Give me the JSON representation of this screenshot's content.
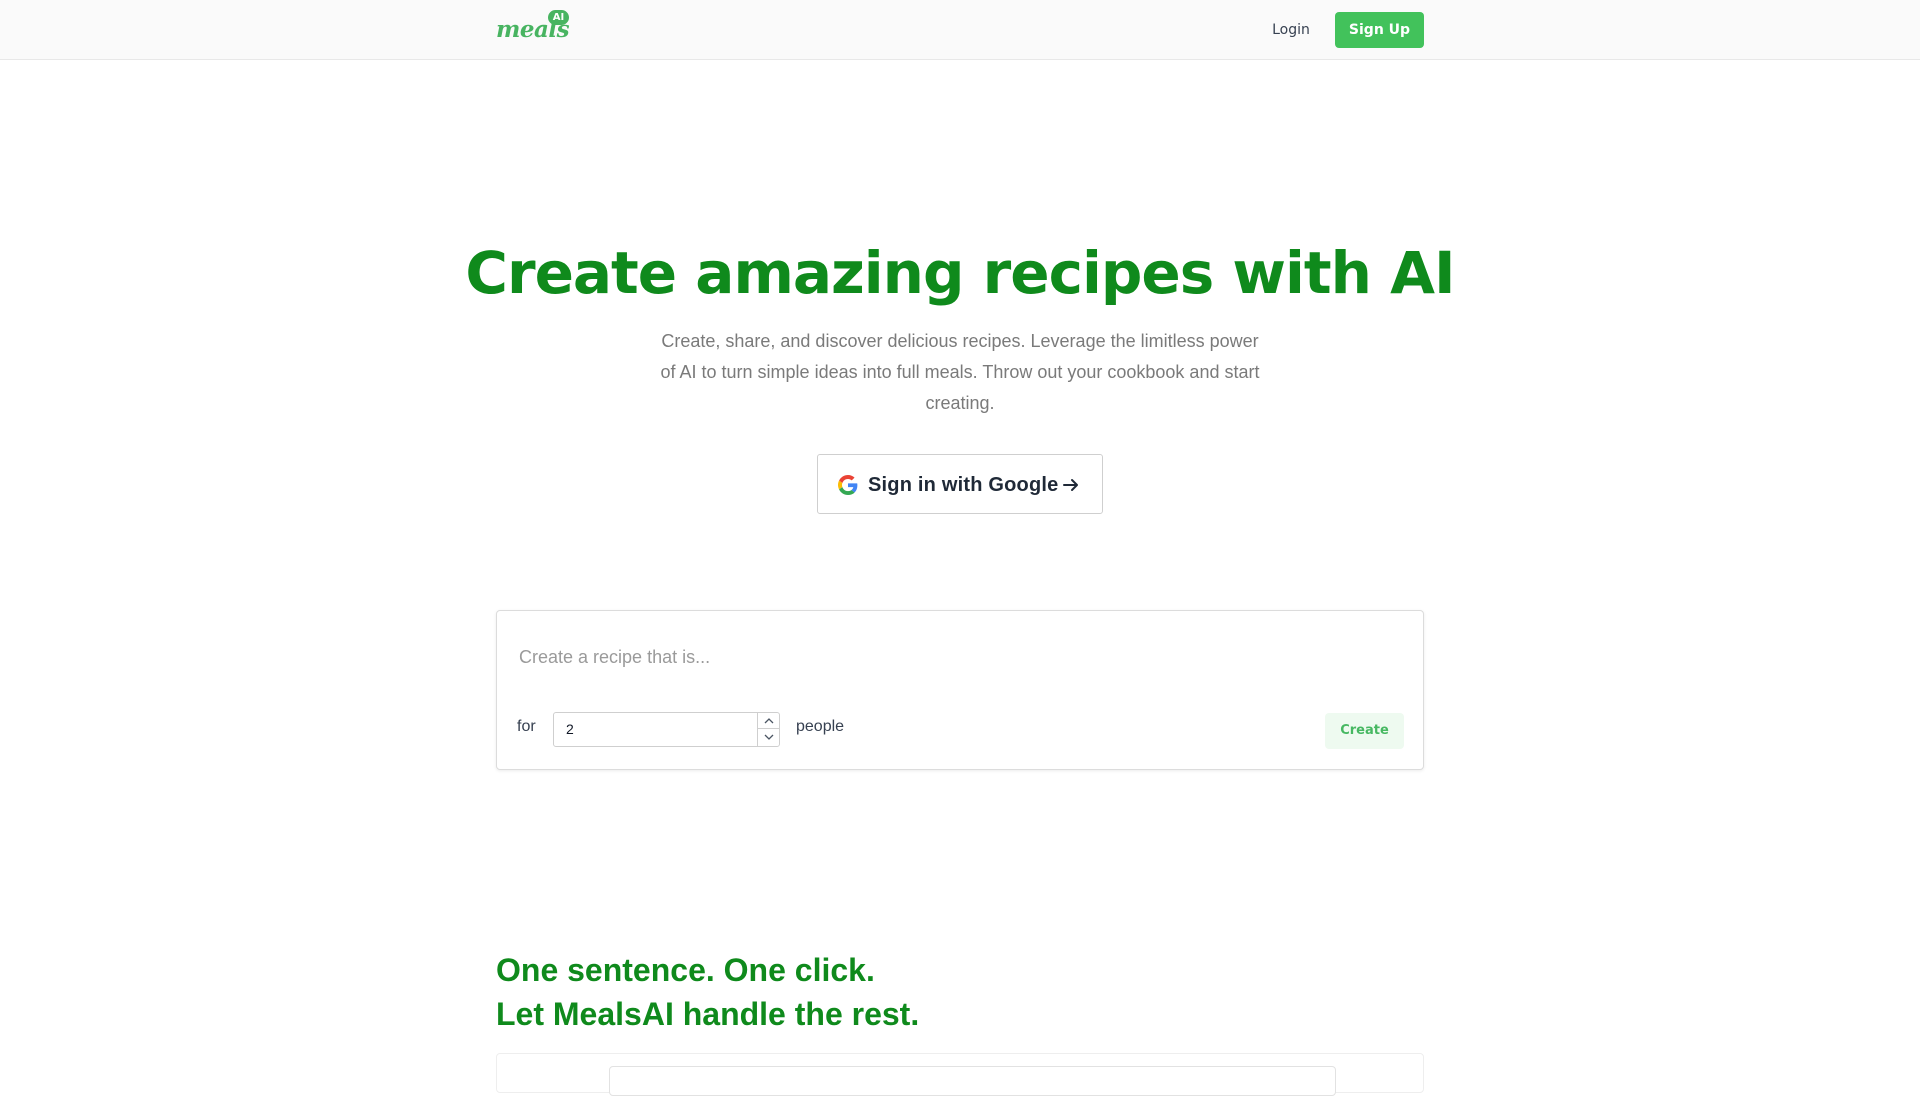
{
  "nav": {
    "logo_word": "meals",
    "logo_badge": "AI",
    "login_label": "Login",
    "signup_label": "Sign Up"
  },
  "hero": {
    "title": "Create amazing recipes with AI",
    "subtitle": "Create, share, and discover delicious recipes. Leverage the limitless power of AI to turn simple ideas into full meals. Throw out your cookbook and start creating.",
    "google_button_label": "Sign in with Google"
  },
  "recipe_form": {
    "placeholder": "Create a recipe that is...",
    "for_label": "for",
    "people_count": "2",
    "people_label": "people",
    "create_label": "Create"
  },
  "tagline": {
    "line1": "One sentence. One click.",
    "line2": "Let MealsAI handle the rest."
  },
  "colors": {
    "brand_green": "#0f8a1c",
    "button_green": "#42c25b",
    "logo_green": "#48b461",
    "create_button_bg": "#eefaf0"
  },
  "icons": {
    "google": "google-g-icon",
    "arrow": "arrow-right-icon",
    "stepper_up": "chevron-up-icon",
    "stepper_down": "chevron-down-icon"
  }
}
